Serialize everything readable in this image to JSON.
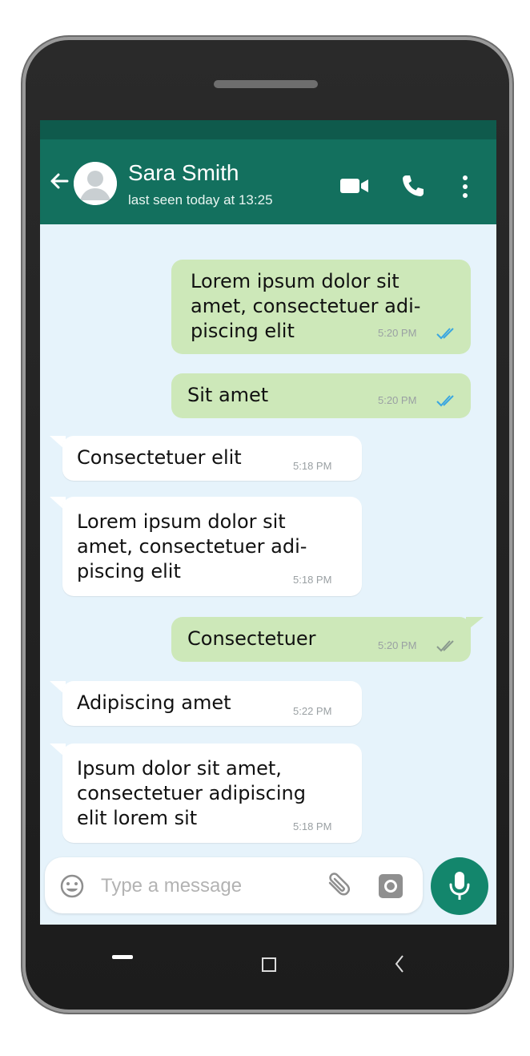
{
  "contact": {
    "name": "Sara Smith",
    "status": "last seen today at 13:25"
  },
  "header_icons": [
    "back-arrow-icon",
    "avatar",
    "video-call-icon",
    "phone-call-icon",
    "more-options-icon"
  ],
  "messages": [
    {
      "direction": "outgoing",
      "text": "Lorem ipsum dolor sit\namet, consectetuer adi-\npiscing elit",
      "time": "5:20 PM",
      "ticks": "double",
      "tick_color": "#3aa6e0"
    },
    {
      "direction": "outgoing",
      "text": "Sit amet",
      "time": "5:20 PM",
      "ticks": "double",
      "tick_color": "#3aa6e0"
    },
    {
      "direction": "incoming",
      "text": "Consectetuer elit",
      "time": "5:18 PM"
    },
    {
      "direction": "incoming",
      "text": "Lorem ipsum dolor sit\namet, consectetuer adi-\npiscing elit",
      "time": "5:18 PM"
    },
    {
      "direction": "outgoing",
      "text": "Consectetuer",
      "time": "5:20 PM",
      "ticks": "double",
      "tick_color": "#8a9a8e"
    },
    {
      "direction": "incoming",
      "text": "Adipiscing amet",
      "time": "5:22 PM"
    },
    {
      "direction": "incoming",
      "text": "Ipsum dolor sit amet,\nconsectetuer adipiscing\nelit lorem sit",
      "time": "5:18 PM"
    }
  ],
  "composer": {
    "placeholder": "Type a message",
    "icons": [
      "emoji-icon",
      "attach-icon",
      "camera-icon",
      "microphone-icon"
    ]
  },
  "colors": {
    "header": "#13705e",
    "status_bar": "#0f5a4c",
    "chat_background": "#e6f3fb",
    "outgoing_bubble": "#cde8b9",
    "incoming_bubble": "#ffffff",
    "mic_button": "#13866c",
    "phone_body": "#1c1c1c"
  },
  "nav_buttons": [
    "recent-apps-icon",
    "home-icon",
    "back-icon"
  ]
}
